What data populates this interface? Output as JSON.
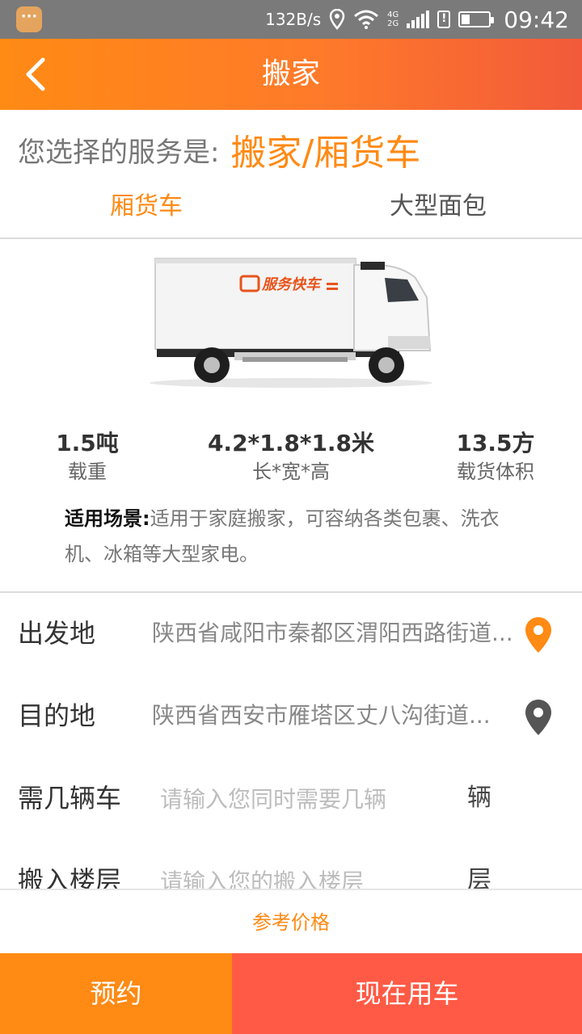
{
  "status_bar": {
    "net_speed": "132B/s",
    "time": "09:42",
    "net_types": [
      "4G",
      "2G"
    ],
    "battery_level": 0.3,
    "icons": [
      "app-icon",
      "location-icon",
      "wifi-icon",
      "signal-icon",
      "alert-icon",
      "battery-icon"
    ]
  },
  "header": {
    "title": "搬家",
    "back_icon": "chevron-left-icon",
    "gradient_start": "#ff8a14",
    "gradient_end": "#f25a3a"
  },
  "service": {
    "prefix": "您选择的服务是:",
    "value": "搬家/厢货车"
  },
  "tabs": [
    {
      "label": "厢货车",
      "active": true
    },
    {
      "label": "大型面包",
      "active": false
    }
  ],
  "truck": {
    "brand_text": "服务快车"
  },
  "specs": [
    {
      "value": "1.5吨",
      "label": "载重"
    },
    {
      "value": "4.2*1.8*1.8米",
      "label": "长*宽*高"
    },
    {
      "value": "13.5方",
      "label": "载货体积"
    }
  ],
  "scenario": {
    "label": "适用场景:",
    "text": "适用于家庭搬家，可容纳各类包裹、洗衣机、冰箱等大型家电。"
  },
  "form": {
    "origin": {
      "label": "出发地",
      "value": "陕西省咸阳市秦都区渭阳西路街道...",
      "pin_color": "#ff8a14"
    },
    "destination": {
      "label": "目的地",
      "value": "陕西省西安市雁塔区丈八沟街道...",
      "pin_color": "#555555"
    },
    "vehicles": {
      "label": "需几辆车",
      "placeholder": "请输入您同时需要几辆",
      "unit": "辆"
    },
    "floor": {
      "label": "搬入楼层",
      "placeholder": "请输入您的搬入楼层",
      "unit": "层"
    }
  },
  "price_link": "参考价格",
  "buttons": {
    "reserve": "预约",
    "now": "现在用车",
    "reserve_color": "#ff8a14",
    "now_color": "#ff5a45"
  }
}
